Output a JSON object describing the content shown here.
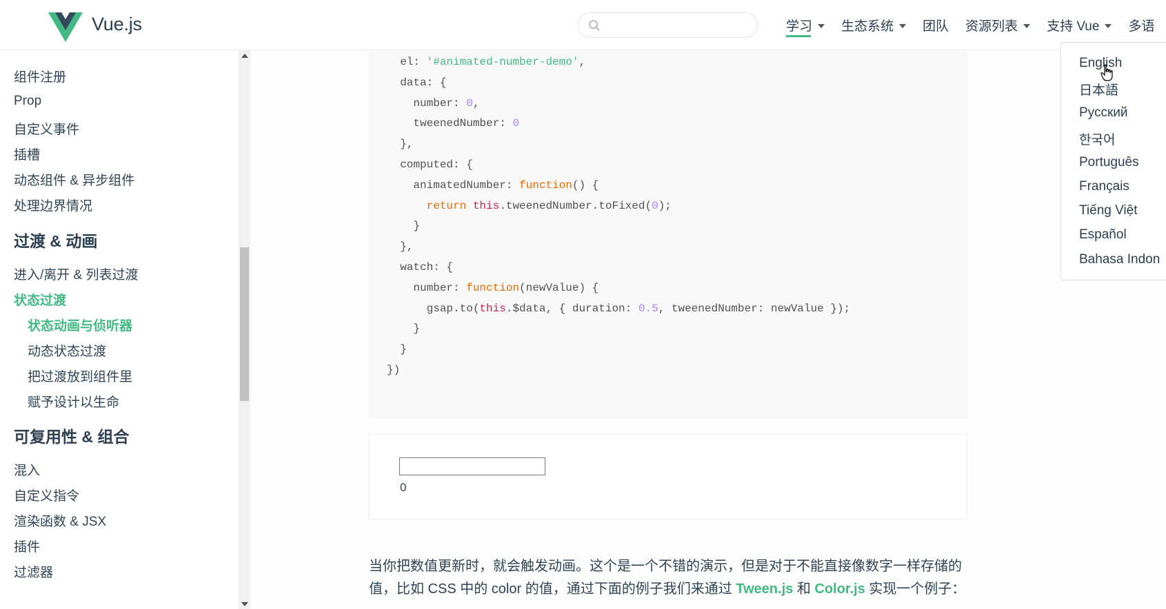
{
  "header": {
    "brand": "Vue.js",
    "search_placeholder": "",
    "nav": [
      {
        "label": "学习",
        "dropdown": true
      },
      {
        "label": "生态系统",
        "dropdown": true
      },
      {
        "label": "团队",
        "dropdown": false
      },
      {
        "label": "资源列表",
        "dropdown": true
      },
      {
        "label": "支持 Vue",
        "dropdown": true
      },
      {
        "label": "多语",
        "dropdown": false
      }
    ]
  },
  "sidebar": {
    "items": [
      "组件注册",
      "Prop",
      "自定义事件",
      "插槽",
      "动态组件 & 异步组件",
      "处理边界情况"
    ],
    "section_transition": "过渡 & 动画",
    "transition_items": [
      "进入/离开 & 列表过渡"
    ],
    "active_item": "状态过渡",
    "sub_items": [
      "状态动画与侦听器",
      "动态状态过渡",
      "把过渡放到组件里",
      "赋予设计以生命"
    ],
    "section_reuse": "可复用性 & 组合",
    "reuse_items": [
      "混入",
      "自定义指令",
      "渲染函数 & JSX",
      "插件",
      "过滤器"
    ]
  },
  "code": {
    "lines": [
      {
        "indent": "  ",
        "parts": [
          [
            "",
            "el: "
          ],
          [
            "str",
            "'#animated-number-demo'"
          ],
          [
            "",
            ","
          ]
        ]
      },
      {
        "indent": "  ",
        "parts": [
          [
            "",
            "data: {"
          ]
        ]
      },
      {
        "indent": "    ",
        "parts": [
          [
            "",
            "number: "
          ],
          [
            "num",
            "0"
          ],
          [
            "",
            ","
          ]
        ]
      },
      {
        "indent": "    ",
        "parts": [
          [
            "",
            "tweenedNumber: "
          ],
          [
            "num",
            "0"
          ]
        ]
      },
      {
        "indent": "  ",
        "parts": [
          [
            "",
            "},"
          ]
        ]
      },
      {
        "indent": "  ",
        "parts": [
          [
            "",
            "computed: {"
          ]
        ]
      },
      {
        "indent": "    ",
        "parts": [
          [
            "",
            "animatedNumber: "
          ],
          [
            "kw",
            "function"
          ],
          [
            "",
            "() {"
          ]
        ]
      },
      {
        "indent": "      ",
        "parts": [
          [
            "kw",
            "return"
          ],
          [
            "",
            " "
          ],
          [
            "fn",
            "this"
          ],
          [
            "",
            ".tweenedNumber.toFixed("
          ],
          [
            "num",
            "0"
          ],
          [
            "",
            ");"
          ]
        ]
      },
      {
        "indent": "    ",
        "parts": [
          [
            "",
            "}"
          ]
        ]
      },
      {
        "indent": "  ",
        "parts": [
          [
            "",
            "},"
          ]
        ]
      },
      {
        "indent": "  ",
        "parts": [
          [
            "",
            "watch: {"
          ]
        ]
      },
      {
        "indent": "    ",
        "parts": [
          [
            "",
            "number: "
          ],
          [
            "kw",
            "function"
          ],
          [
            "",
            "(newValue) {"
          ]
        ]
      },
      {
        "indent": "      ",
        "parts": [
          [
            "",
            "gsap.to("
          ],
          [
            "fn",
            "this"
          ],
          [
            "",
            ".$data, { duration: "
          ],
          [
            "num",
            "0.5"
          ],
          [
            "",
            ", tweenedNumber: newValue });"
          ]
        ]
      },
      {
        "indent": "    ",
        "parts": [
          [
            "",
            "}"
          ]
        ]
      },
      {
        "indent": "  ",
        "parts": [
          [
            "",
            "}"
          ]
        ]
      },
      {
        "indent": "",
        "parts": [
          [
            "",
            "})"
          ]
        ]
      }
    ]
  },
  "demo": {
    "input_value": "",
    "output": "0"
  },
  "paragraph": {
    "line1": "当你把数值更新时，就会触发动画。这个是一个不错的演示，但是对于不能直接像数字一样存储的",
    "line2_pre": "值，比如 CSS 中的 color 的值，通过下面的例子我们来通过 ",
    "link1": "Tween.js",
    "line2_mid": " 和 ",
    "link2": "Color.js",
    "line2_post": " 实现一个例子："
  },
  "languages": [
    "English",
    "日本語",
    "Русский",
    "한국어",
    "Português",
    "Français",
    "Tiếng Việt",
    "Español",
    "Bahasa Indon"
  ],
  "colors": {
    "accent": "#42b983",
    "text": "#304455",
    "code_bg": "#f8f8f8"
  }
}
